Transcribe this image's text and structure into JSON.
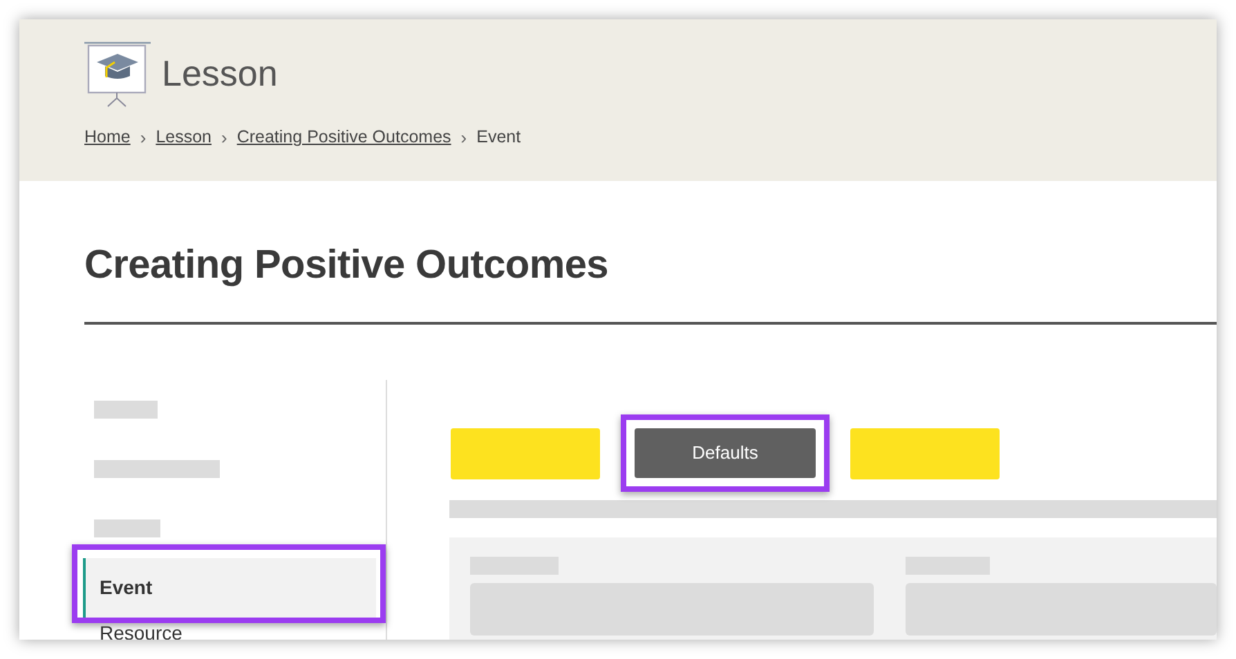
{
  "header": {
    "title": "Lesson",
    "breadcrumb": [
      {
        "label": "Home",
        "link": true
      },
      {
        "label": "Lesson",
        "link": true
      },
      {
        "label": "Creating Positive Outcomes",
        "link": true
      },
      {
        "label": "Event",
        "link": false
      }
    ],
    "separator": "›"
  },
  "page_title": "Creating Positive Outcomes",
  "sidebar": {
    "items": [
      {
        "kind": "placeholder",
        "highlighted": false
      },
      {
        "kind": "placeholder",
        "highlighted": false
      },
      {
        "kind": "placeholder",
        "highlighted": false
      },
      {
        "kind": "link",
        "label": "Event",
        "selected": true,
        "highlighted": true
      },
      {
        "kind": "link",
        "label": "Resource",
        "selected": false,
        "highlighted": false
      }
    ]
  },
  "toolbar": [
    {
      "kind": "placeholder",
      "highlighted": false
    },
    {
      "kind": "button",
      "label": "Defaults",
      "highlighted": true
    },
    {
      "kind": "placeholder",
      "highlighted": false
    }
  ]
}
